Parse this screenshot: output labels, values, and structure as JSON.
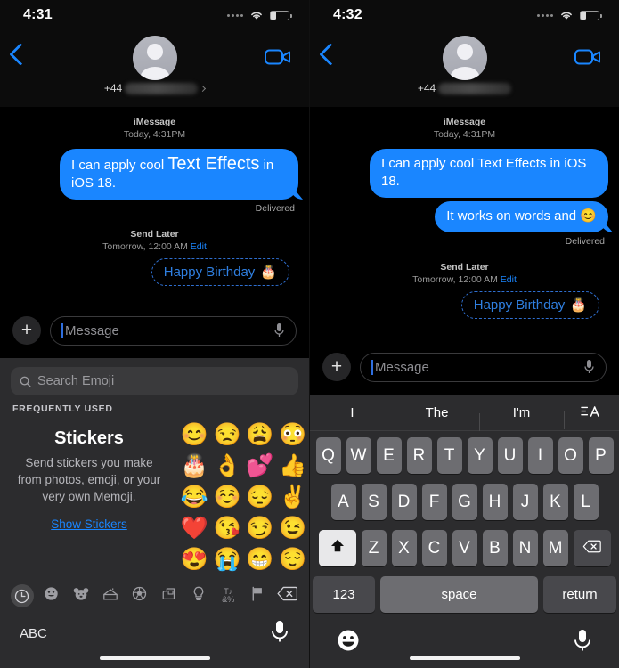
{
  "left": {
    "status": {
      "time": "4:31",
      "signal_dots": 4,
      "wifi": "wifi-icon",
      "battery_level_pct": 30
    },
    "header": {
      "back": "back-chevron",
      "facetime": "video-camera-icon",
      "contact_prefix": "+44",
      "contact_name_redacted": true
    },
    "conversation": {
      "service_label": "iMessage",
      "timestamp": "Today, 4:31PM",
      "messages": [
        {
          "parts": [
            {
              "text": "I  can apply cool ",
              "effect": "none"
            },
            {
              "text": "Text Effects",
              "effect": "big"
            },
            {
              "text": " in iOS 18.",
              "effect": "none"
            }
          ],
          "status": "Delivered"
        }
      ],
      "send_later": {
        "title": "Send Later",
        "when": "Tomorrow, 12:00 AM",
        "edit_label": "Edit",
        "bubble_text": "Happy Birthday",
        "bubble_emoji": "🎂"
      }
    },
    "input": {
      "plus": "+",
      "placeholder": "Message",
      "mic": "mic-icon"
    },
    "emoji_keyboard": {
      "search_placeholder": "Search Emoji",
      "section_label": "FREQUENTLY USED",
      "stickers": {
        "title": "Stickers",
        "description": "Send stickers you make from photos, emoji, or your very own Memoji.",
        "link": "Show Stickers"
      },
      "emojis": [
        "😊",
        "😒",
        "😩",
        "😳",
        "🎂",
        "👌",
        "💕",
        "👍",
        "😂",
        "☺️",
        "😔",
        "✌️",
        "❤️",
        "😘",
        "😏",
        "😉",
        "😍",
        "😭",
        "😁",
        "😌"
      ],
      "category_tabs": [
        "recents-clock-icon",
        "smileys-icon",
        "animals-bear-icon",
        "food-cake-icon",
        "activity-ball-icon",
        "travel-car-icon",
        "objects-bulb-icon",
        "symbols-icon",
        "flags-icon",
        "delete-backspace-icon"
      ],
      "selected_tab_index": 0,
      "abc_label": "ABC",
      "mic": "mic-icon"
    }
  },
  "right": {
    "status": {
      "time": "4:32",
      "signal_dots": 4,
      "wifi": "wifi-icon",
      "battery_level_pct": 30
    },
    "header": {
      "back": "back-chevron",
      "facetime": "video-camera-icon",
      "contact_prefix": "+44",
      "contact_name_redacted": true
    },
    "conversation": {
      "service_label": "iMessage",
      "timestamp": "Today, 4:31PM",
      "messages": [
        {
          "text": "I  can apply cool Text Effects in iOS 18.",
          "status": ""
        },
        {
          "text": "It works on words and 😊",
          "status": "Delivered"
        }
      ],
      "send_later": {
        "title": "Send Later",
        "when": "Tomorrow, 12:00 AM",
        "edit_label": "Edit",
        "bubble_text": "Happy Birthday",
        "bubble_emoji": "🎂"
      }
    },
    "input": {
      "plus": "+",
      "placeholder": "Message",
      "mic": "mic-icon"
    },
    "keyboard": {
      "predictive": [
        "I",
        "The",
        "I'm"
      ],
      "format_icon": "text-format-icon",
      "row1": [
        "Q",
        "W",
        "E",
        "R",
        "T",
        "Y",
        "U",
        "I",
        "O",
        "P"
      ],
      "row2": [
        "A",
        "S",
        "D",
        "F",
        "G",
        "H",
        "J",
        "K",
        "L"
      ],
      "row3": [
        "Z",
        "X",
        "C",
        "V",
        "B",
        "N",
        "M"
      ],
      "shift": "shift-arrow-icon",
      "shift_active": true,
      "delete": "delete-backspace-icon",
      "numbers_label": "123",
      "space_label": "space",
      "return_label": "return",
      "emoji_key": "emoji-smiley-icon",
      "dictation": "mic-icon"
    }
  },
  "colors": {
    "bubble_blue": "#1a86ff",
    "accent_blue": "#1a86ff",
    "keyboard_bg": "#2c2c2e",
    "key_bg": "#6d6d71",
    "scheduled_border": "#2f6fd0"
  }
}
